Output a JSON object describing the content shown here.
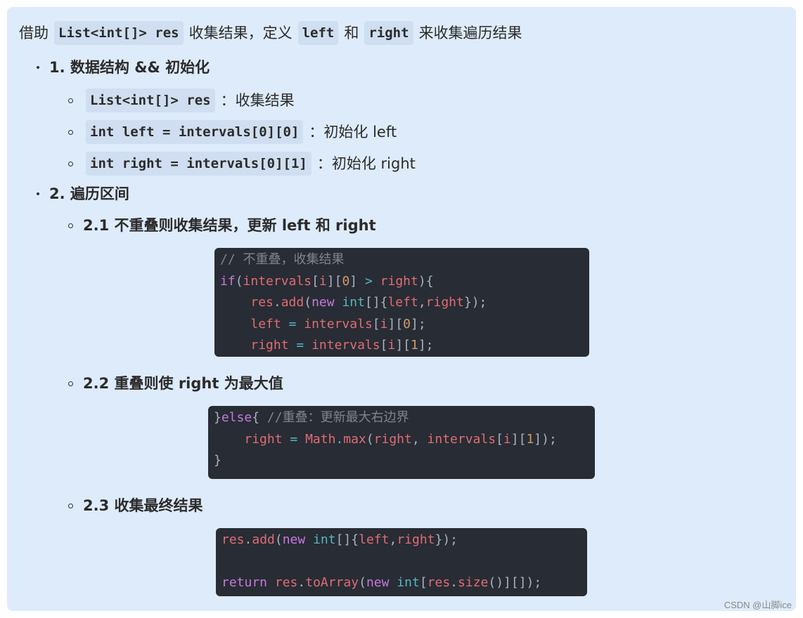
{
  "intro": {
    "prefix": "借助",
    "code1": "List<int[]> res",
    "mid1": "收集结果，定义",
    "code2": "left",
    "mid2": "和",
    "code3": "right",
    "suffix": "来收集遍历结果"
  },
  "section1": {
    "title": "1. 数据结构 && 初始化",
    "items": [
      {
        "code": "List<int[]> res",
        "desc": "：收集结果"
      },
      {
        "code": "int left = intervals[0][0]",
        "desc": "：初始化 left"
      },
      {
        "code": "int right = intervals[0][1]",
        "desc": "：初始化 right"
      }
    ]
  },
  "section2": {
    "title": "2. 遍历区间",
    "sub1": {
      "title": "2.1 不重叠则收集结果，更新 left 和 right",
      "code_lines": [
        "// 不重叠，收集结果",
        "if(intervals[i][0] > right){",
        "    res.add(new int[]{left,right});",
        "    left = intervals[i][0];",
        "    right = intervals[i][1];"
      ]
    },
    "sub2": {
      "title": "2.2 重叠则使 right 为最大值",
      "code_lines": [
        "}else{ //重叠：更新最大右边界",
        "    right = Math.max(right, intervals[i][1]);",
        "}"
      ]
    },
    "sub3": {
      "title": "2.3 收集最终结果",
      "code_lines": [
        "res.add(new int[]{left,right});",
        "",
        "return res.toArray(new int[res.size()][]);"
      ]
    }
  },
  "watermark": "CSDN @山脚ice",
  "colors": {
    "panel_bg": "#deebfb",
    "code_bg": "#282c34",
    "keyword": "#c678dd",
    "variable": "#e06c75",
    "number": "#d19a66",
    "type": "#56b6c2",
    "comment": "#7f848e"
  }
}
